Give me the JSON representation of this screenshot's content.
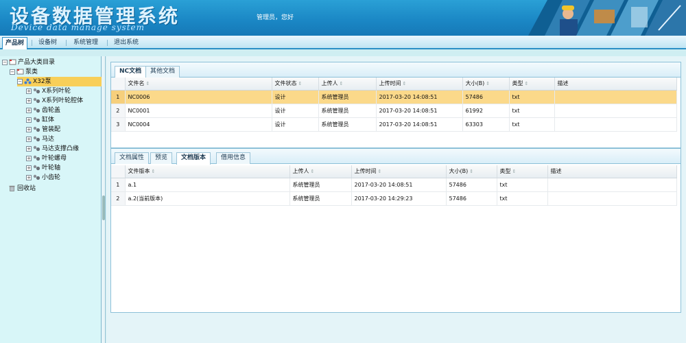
{
  "header": {
    "title": "设备数据管理系统",
    "subtitle": "Device data manage system",
    "welcome": "管理员，您好"
  },
  "menu": [
    {
      "label": "产品树",
      "active": true
    },
    {
      "label": "设备树",
      "active": false
    },
    {
      "label": "系统管理",
      "active": false
    },
    {
      "label": "退出系统",
      "active": false
    }
  ],
  "tree": {
    "root": "产品大类目录",
    "pump": "泵类",
    "selected": "X32泵",
    "children": [
      "X系列叶轮",
      "X系列叶轮腔体",
      "齿轮盖",
      "缸体",
      "管装配",
      "马达",
      "马达支撑凸缘",
      "叶轮螺母",
      "叶轮轴",
      "小齿轮"
    ],
    "recycle": "回收站"
  },
  "top_panel": {
    "tabs": [
      {
        "label": "NC文档",
        "active": true
      },
      {
        "label": "其他文档",
        "active": false
      }
    ],
    "columns": [
      "文件名",
      "文件状态",
      "上传人",
      "上传时间",
      "大小(B)",
      "类型",
      "描述"
    ],
    "rows": [
      {
        "index": "1",
        "name": "NC0006",
        "status": "设计",
        "uploader": "系统管理员",
        "time": "2017-03-20 14:08:51",
        "size": "57486",
        "type": "txt",
        "desc": ""
      },
      {
        "index": "2",
        "name": "NC0001",
        "status": "设计",
        "uploader": "系统管理员",
        "time": "2017-03-20 14:08:51",
        "size": "61992",
        "type": "txt",
        "desc": ""
      },
      {
        "index": "3",
        "name": "NC0004",
        "status": "设计",
        "uploader": "系统管理员",
        "time": "2017-03-20 14:08:51",
        "size": "63303",
        "type": "txt",
        "desc": ""
      }
    ],
    "selected_row": 0
  },
  "bottom_panel": {
    "tabs": [
      {
        "label": "文档属性",
        "active": false
      },
      {
        "label": "预览",
        "active": false
      },
      {
        "label": "文档版本",
        "active": true
      },
      {
        "label": "借用信息",
        "active": false
      }
    ],
    "columns": [
      "文件版本",
      "上传人",
      "上传时间",
      "大小(B)",
      "类型",
      "描述"
    ],
    "rows": [
      {
        "index": "1",
        "version": "a.1",
        "uploader": "系统管理员",
        "time": "2017-03-20 14:08:51",
        "size": "57486",
        "type": "txt",
        "desc": ""
      },
      {
        "index": "2",
        "version": "a.2(当前版本)",
        "uploader": "系统管理员",
        "time": "2017-03-20 14:29:23",
        "size": "57486",
        "type": "txt",
        "desc": ""
      }
    ]
  },
  "colors": {
    "header": "#1a86c4",
    "selection": "#fbd98a",
    "tree_selection": "#f8cf59",
    "border": "#8cc0d8"
  }
}
